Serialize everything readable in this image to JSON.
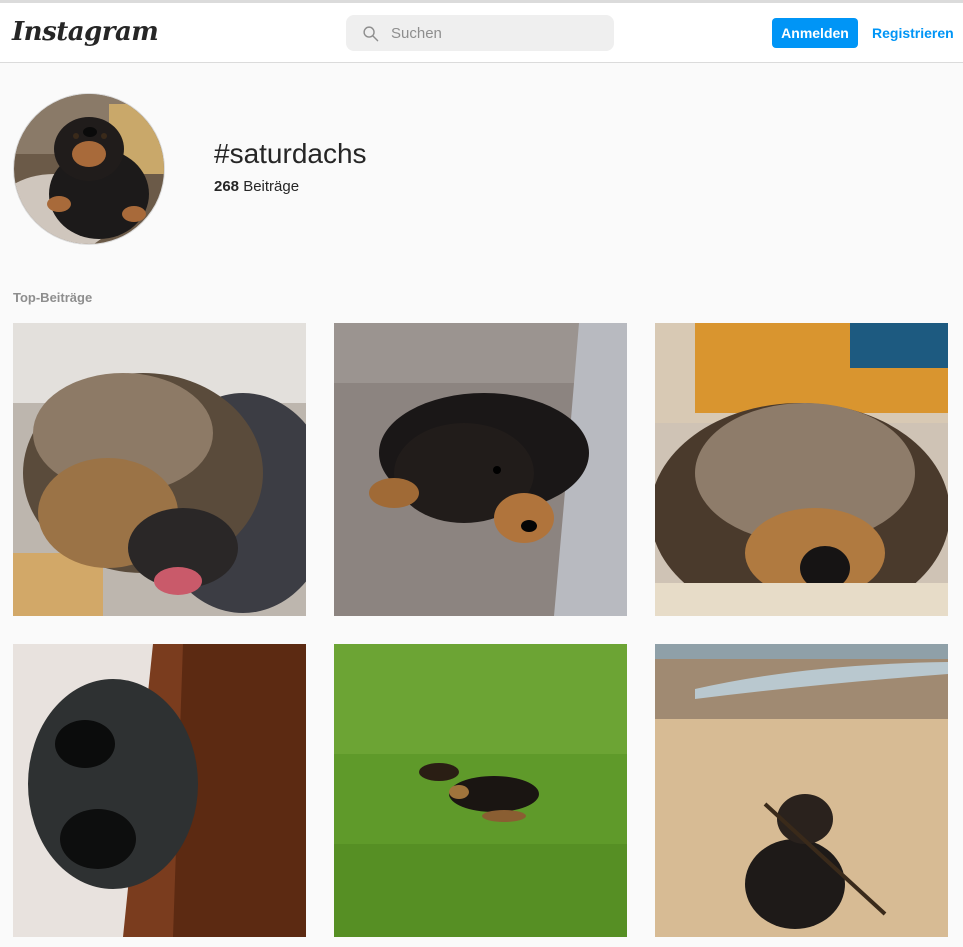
{
  "header": {
    "logo": "Instagram",
    "search": {
      "placeholder": "Suchen",
      "value": ""
    },
    "login_label": "Anmelden",
    "register_label": "Registrieren"
  },
  "profile": {
    "hashtag": "#saturdachs",
    "post_count": "268",
    "post_count_label": "Beiträge"
  },
  "section": {
    "title": "Top-Beiträge"
  },
  "posts": [
    {
      "description": ""
    },
    {
      "description": ""
    },
    {
      "description": ""
    },
    {
      "description": ""
    },
    {
      "description": ""
    },
    {
      "description": ""
    }
  ],
  "colors": {
    "accent": "#0095f6",
    "background": "#fafafa",
    "border": "#dbdbdb",
    "muted": "#8e8e8e"
  },
  "icons": {
    "search": "search-icon"
  }
}
